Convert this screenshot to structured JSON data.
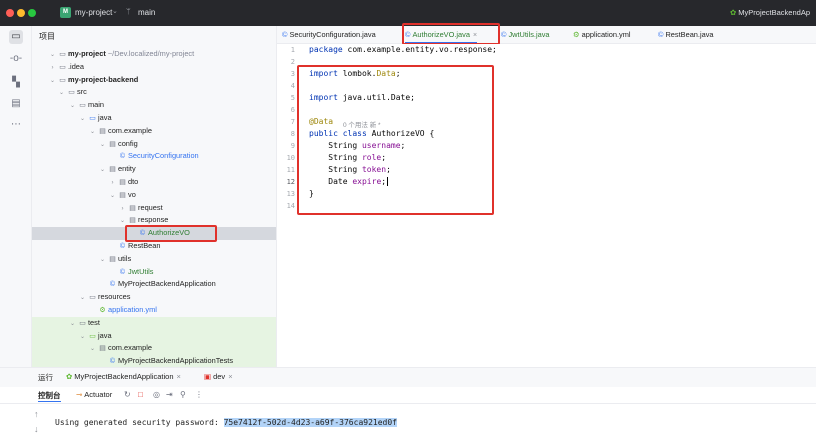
{
  "titlebar": {
    "project_badge": "M",
    "project_name": "my-project",
    "branch": "main",
    "run_config": "MyProjectBackendAp"
  },
  "project_panel": {
    "title": "项目",
    "rows": [
      {
        "chev": "⌄",
        "icon": "▭",
        "label": "my-project",
        "suffix": " ~/Dev.localized/my-project"
      },
      {
        "chev": "›",
        "icon": "▭",
        "label": ".idea"
      },
      {
        "chev": "⌄",
        "icon": "▭",
        "label": "my-project-backend"
      },
      {
        "chev": "⌄",
        "icon": "▭",
        "label": "src"
      },
      {
        "chev": "⌄",
        "icon": "▭",
        "label": "main"
      },
      {
        "chev": "⌄",
        "icon": "▭",
        "label": "java"
      },
      {
        "chev": "⌄",
        "icon": "▤",
        "label": "com.example"
      },
      {
        "chev": "⌄",
        "icon": "▤",
        "label": "config"
      },
      {
        "chev": "",
        "icon": "©",
        "label": "SecurityConfiguration"
      },
      {
        "chev": "⌄",
        "icon": "▤",
        "label": "entity"
      },
      {
        "chev": "›",
        "icon": "▤",
        "label": "dto"
      },
      {
        "chev": "⌄",
        "icon": "▤",
        "label": "vo"
      },
      {
        "chev": "›",
        "icon": "▤",
        "label": "request"
      },
      {
        "chev": "⌄",
        "icon": "▤",
        "label": "response"
      },
      {
        "chev": "",
        "icon": "©",
        "label": "AuthorizeVO"
      },
      {
        "chev": "",
        "icon": "©",
        "label": "RestBean"
      },
      {
        "chev": "⌄",
        "icon": "▤",
        "label": "utils"
      },
      {
        "chev": "",
        "icon": "©",
        "label": "JwtUtils"
      },
      {
        "chev": "",
        "icon": "©",
        "label": "MyProjectBackendApplication"
      },
      {
        "chev": "⌄",
        "icon": "▭",
        "label": "resources"
      },
      {
        "chev": "",
        "icon": "⚙",
        "label": "application.yml"
      },
      {
        "chev": "⌄",
        "icon": "▭",
        "label": "test"
      },
      {
        "chev": "⌄",
        "icon": "▭",
        "label": "java"
      },
      {
        "chev": "⌄",
        "icon": "▤",
        "label": "com.example"
      },
      {
        "chev": "",
        "icon": "©",
        "label": "MyProjectBackendApplicationTests"
      }
    ]
  },
  "editor_tabs": [
    {
      "label": "SecurityConfiguration.java",
      "icon": "©"
    },
    {
      "label": "AuthorizeVO.java",
      "icon": "©",
      "close": "×"
    },
    {
      "label": "JwtUtils.java",
      "icon": "©"
    },
    {
      "label": "application.yml",
      "icon": "⚙"
    },
    {
      "label": "RestBean.java",
      "icon": "©"
    }
  ],
  "editor": {
    "line_numbers": [
      "1",
      "2",
      "3",
      "4",
      "5",
      "6",
      "7",
      "8",
      "9",
      "10",
      "11",
      "12",
      "13",
      "14"
    ],
    "l1_kw": "package",
    "l1_rest": " com.example.entity.vo.response;",
    "l3_kw": "import",
    "l3_pkg": " lombok.",
    "l3_cls": "Data",
    "l3_end": ";",
    "l5_kw": "import",
    "l5_rest": " java.util.Date;",
    "l7_ann": "@Data",
    "l7_inlay": "0 个用法   新 *",
    "l8_kw1": "public",
    "l8_kw2": "class",
    "l8_rest": " AuthorizeVO {",
    "fields": [
      {
        "type": "    String ",
        "name": "username",
        "end": ";"
      },
      {
        "type": "    String ",
        "name": "role",
        "end": ";"
      },
      {
        "type": "    String ",
        "name": "token",
        "end": ";"
      },
      {
        "type": "    Date ",
        "name": "expire",
        "end": ";"
      }
    ],
    "l13": "}"
  },
  "bottom_panel": {
    "run_label": "运行",
    "run_tab": "MyProjectBackendApplication",
    "dev_tab": "dev",
    "console_label": "控制台",
    "actuator_label": "Actuator",
    "console_prefix": "Using generated security password: ",
    "console_password": "75e7412f-502d-4d23-a69f-376ca921ed0f"
  },
  "colors": {
    "annotation_red": "#e0312b",
    "accent_blue": "#3574f0",
    "spring_green": "#5fb832"
  }
}
